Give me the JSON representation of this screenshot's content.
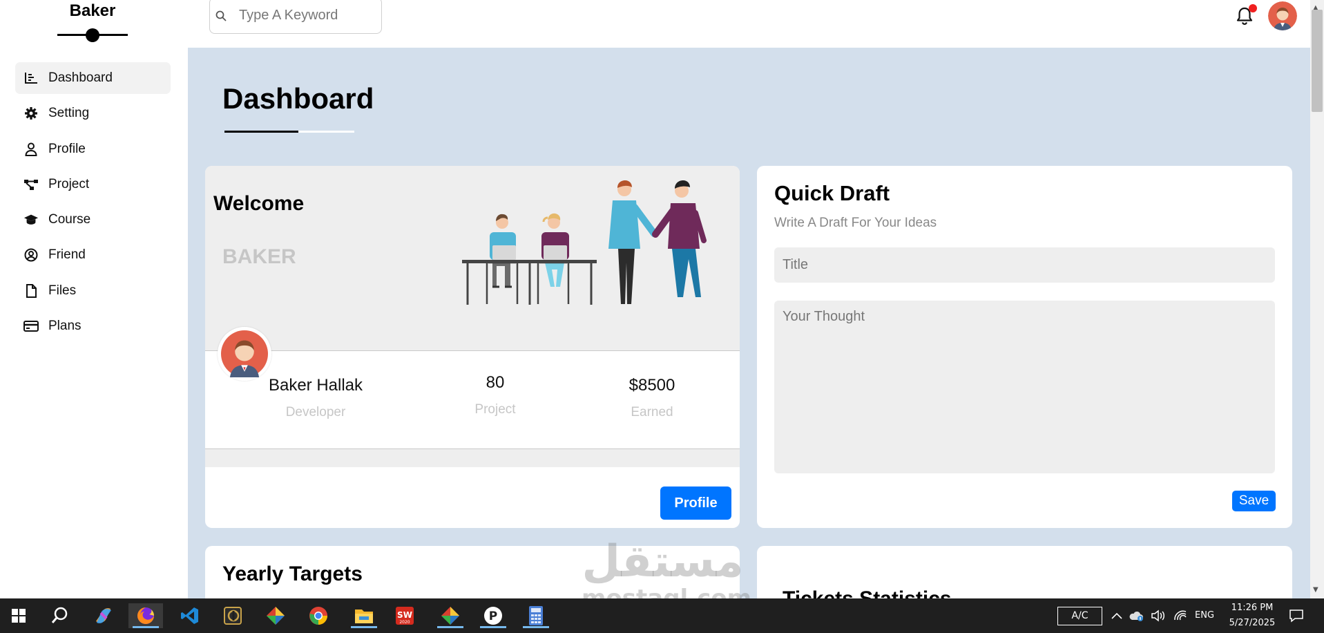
{
  "brand": {
    "name": "Baker"
  },
  "sidebar": {
    "items": [
      {
        "label": "Dashboard",
        "icon": "chart-line-icon",
        "active": true
      },
      {
        "label": "Setting",
        "icon": "gear-icon"
      },
      {
        "label": "Profile",
        "icon": "user-icon"
      },
      {
        "label": "Project",
        "icon": "diagram-project-icon"
      },
      {
        "label": "Course",
        "icon": "graduation-cap-icon"
      },
      {
        "label": "Friend",
        "icon": "user-circle-icon"
      },
      {
        "label": "Files",
        "icon": "file-icon"
      },
      {
        "label": "Plans",
        "icon": "credit-card-icon"
      }
    ]
  },
  "header": {
    "search_placeholder": "Type A Keyword",
    "notification_badge_color": "#f02020"
  },
  "main": {
    "page_title": "Dashboard",
    "background_color": "#d3dfec",
    "accent_color": "#0075ff",
    "welcome": {
      "title": "Welcome",
      "brand": "BAKER",
      "user_name": "Baker Hallak",
      "user_role": "Developer",
      "projects_value": "80",
      "projects_label": "Project",
      "earned_value": "$8500",
      "earned_label": "Earned",
      "profile_button": "Profile"
    },
    "quick_draft": {
      "title": "Quick Draft",
      "subtitle": "Write A Draft For Your Ideas",
      "title_placeholder": "Title",
      "thought_placeholder": "Your Thought",
      "save_button": "Save"
    },
    "yearly_targets": {
      "title": "Yearly Targets"
    },
    "tickets_statistics": {
      "title": "Tickets Statistics"
    }
  },
  "watermark": {
    "arabic": "مستقل",
    "latin": "mostaql.com"
  },
  "taskbar": {
    "apps": [
      "windows-start-icon",
      "search-icon",
      "copilot-icon",
      "firefox-icon",
      "vscode-icon",
      "geogebra-icon",
      "git-icon",
      "chrome-icon",
      "file-explorer-icon",
      "solidworks-icon",
      "git-icon-2",
      "postman-icon",
      "calculator-icon"
    ],
    "ac_label": "A/C",
    "language": "ENG",
    "time": "11:26 PM",
    "date": "5/27/2025"
  }
}
